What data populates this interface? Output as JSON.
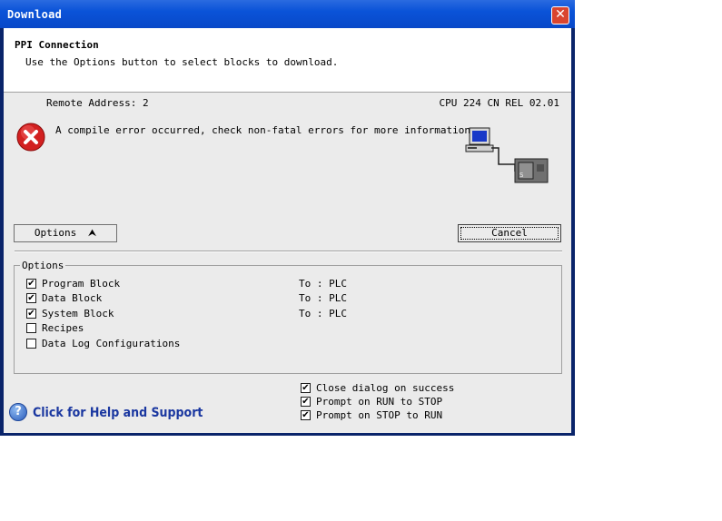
{
  "window": {
    "title": "Download",
    "close_glyph": "✕"
  },
  "header": {
    "title": "PPI Connection",
    "subtitle": "Use the Options button to select blocks to download."
  },
  "connection": {
    "remote_address": "Remote Address: 2",
    "cpu": "CPU 224 CN REL 02.01"
  },
  "message": {
    "icon": "error-icon",
    "text": "A compile error occurred, check non-fatal errors for more information."
  },
  "buttons": {
    "options": "Options",
    "options_arrow": "⮝",
    "cancel": "Cancel"
  },
  "options_group": {
    "label": "Options",
    "items": [
      {
        "label": "Program Block",
        "checked": true,
        "target": "To : PLC"
      },
      {
        "label": "Data Block",
        "checked": true,
        "target": "To : PLC"
      },
      {
        "label": "System Block",
        "checked": true,
        "target": "To : PLC"
      },
      {
        "label": "Recipes",
        "checked": false,
        "target": ""
      },
      {
        "label": "Data Log Configurations",
        "checked": false,
        "target": ""
      }
    ]
  },
  "settings": [
    {
      "label": "Close dialog on success",
      "checked": true
    },
    {
      "label": "Prompt on RUN to STOP",
      "checked": true
    },
    {
      "label": "Prompt on STOP to RUN",
      "checked": true
    }
  ],
  "help": {
    "icon": "help-icon",
    "glyph": "?",
    "link": "Click for Help and Support"
  },
  "check_glyph": "✔",
  "colors": {
    "title_bar": "#0a53d8",
    "dialog_bg": "#ebebeb",
    "help_link": "#1a37a0",
    "error": "#d22020"
  }
}
